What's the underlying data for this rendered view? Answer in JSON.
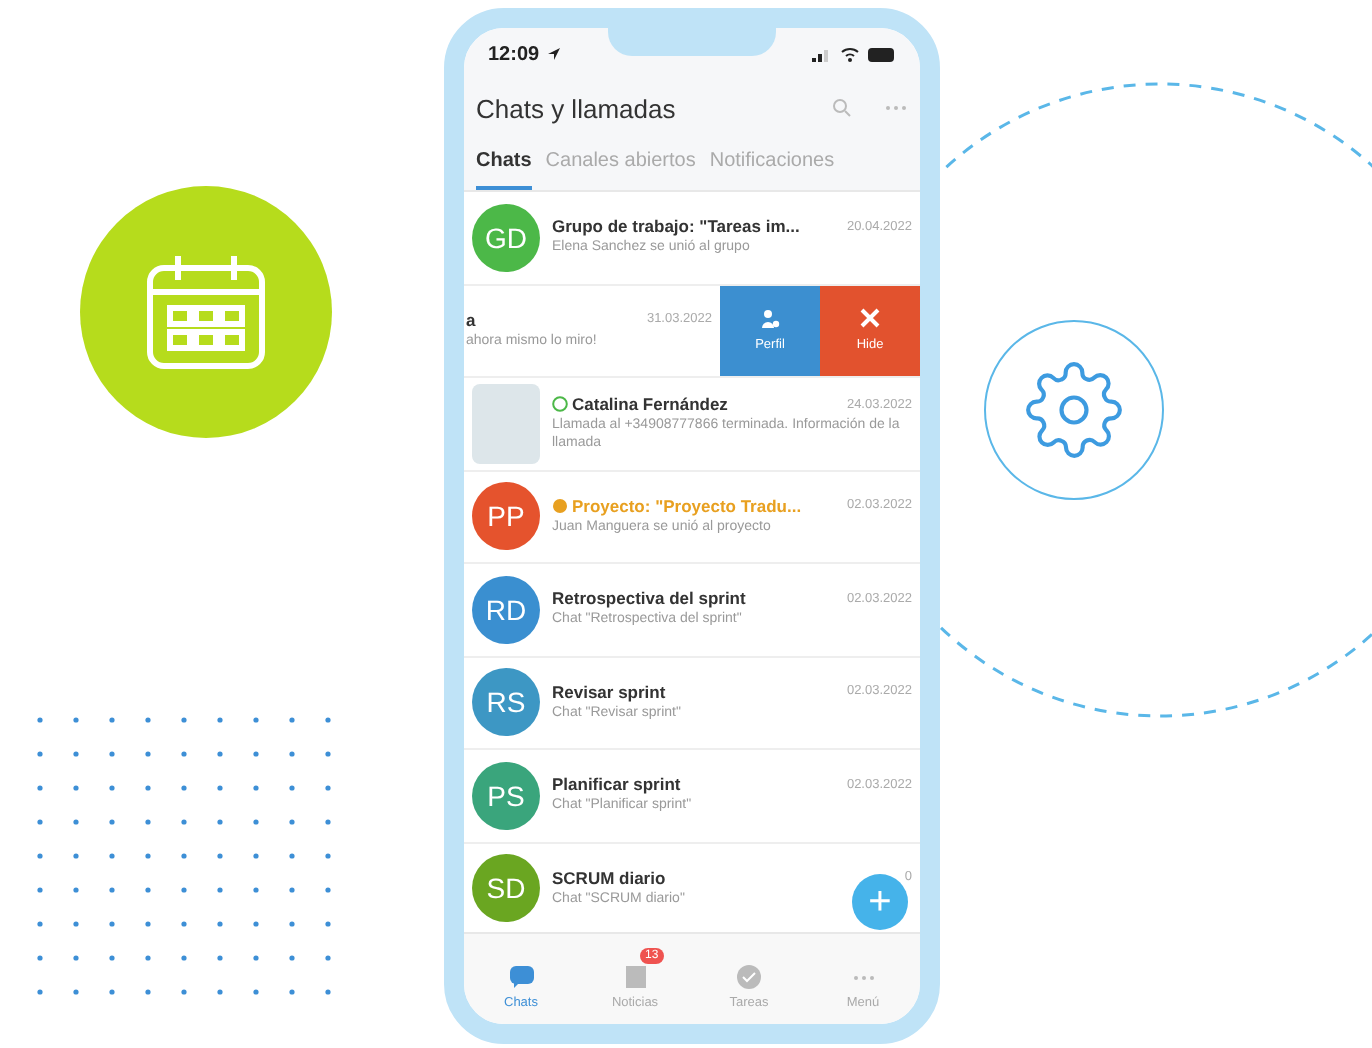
{
  "status_bar": {
    "time": "12:09"
  },
  "header": {
    "title": "Chats y llamadas"
  },
  "tabs": [
    {
      "label": "Chats",
      "selected": true
    },
    {
      "label": "Canales abiertos",
      "selected": false
    },
    {
      "label": "Notificaciones",
      "selected": false
    }
  ],
  "chats": [
    {
      "kind": "chat",
      "initials": "GD",
      "color": "#4cb848",
      "title": "Grupo de trabajo: \"Tareas im...",
      "date": "20.04.2022",
      "preview": "Elena Sanchez se unió al grupo"
    },
    {
      "kind": "swiped",
      "title": "a",
      "date": "31.03.2022",
      "preview": "ahora mismo lo miro!",
      "actions": [
        {
          "label": "Perfil",
          "kind": "profile"
        },
        {
          "label": "Hide",
          "kind": "hide"
        }
      ]
    },
    {
      "kind": "call",
      "title": "Catalina Fernández",
      "date": "24.03.2022",
      "preview": "Llamada al +34908777866 terminada. Información de la llamada"
    },
    {
      "kind": "project",
      "initials": "PP",
      "color": "#e5532d",
      "title": "Proyecto: \"Proyecto Tradu...",
      "date": "02.03.2022",
      "preview": "Juan Manguera se unió al proyecto"
    },
    {
      "kind": "chat",
      "initials": "RD",
      "color": "#3a8fd0",
      "title": "Retrospectiva del sprint",
      "date": "02.03.2022",
      "preview": "Chat \"Retrospectiva del sprint\""
    },
    {
      "kind": "chat",
      "initials": "RS",
      "color": "#3d97c4",
      "title": "Revisar sprint",
      "date": "02.03.2022",
      "preview": "Chat \"Revisar sprint\""
    },
    {
      "kind": "chat",
      "initials": "PS",
      "color": "#3aa57c",
      "title": "Planificar sprint",
      "date": "02.03.2022",
      "preview": "Chat \"Planificar sprint\""
    },
    {
      "kind": "chat",
      "initials": "SD",
      "color": "#6aa621",
      "title": "SCRUM diario",
      "date": "0",
      "preview": "Chat \"SCRUM diario\""
    }
  ],
  "fab": {
    "label": "+"
  },
  "bottom_nav": [
    {
      "label": "Chats",
      "kind": "chats",
      "selected": true
    },
    {
      "label": "Noticias",
      "kind": "news",
      "selected": false,
      "badge": "13"
    },
    {
      "label": "Tareas",
      "kind": "tasks",
      "selected": false
    },
    {
      "label": "Menú",
      "kind": "menu",
      "selected": false
    }
  ]
}
